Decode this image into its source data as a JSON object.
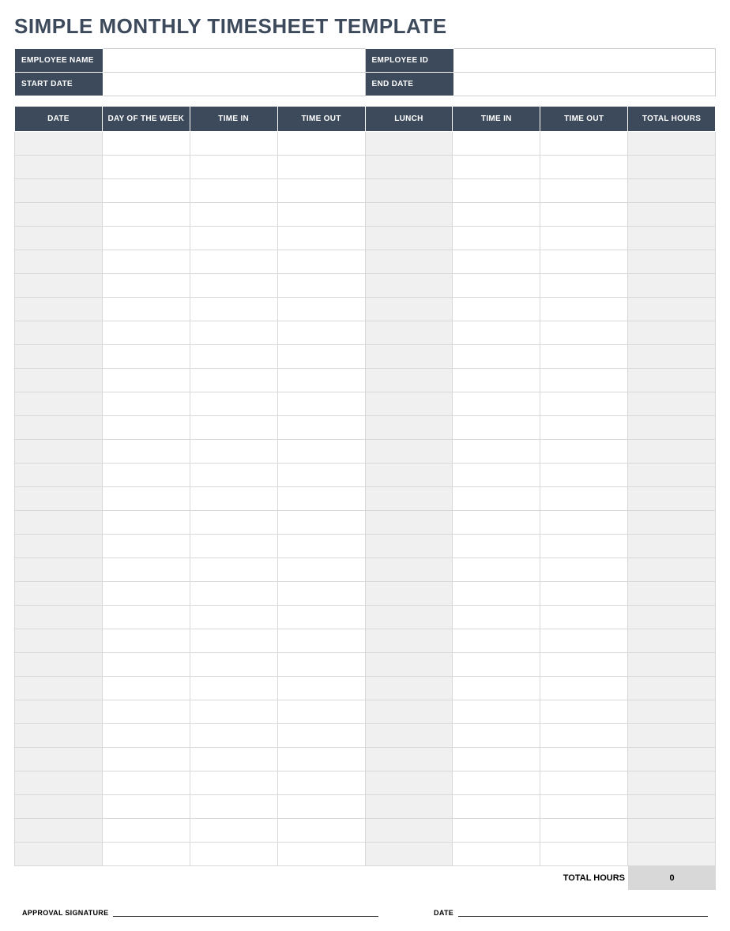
{
  "title": "SIMPLE MONTHLY TIMESHEET TEMPLATE",
  "info": {
    "employee_name_label": "EMPLOYEE NAME",
    "employee_name_value": "",
    "employee_id_label": "EMPLOYEE ID",
    "employee_id_value": "",
    "start_date_label": "START DATE",
    "start_date_value": "",
    "end_date_label": "END DATE",
    "end_date_value": ""
  },
  "columns": {
    "date": "DATE",
    "day_of_week": "DAY OF THE WEEK",
    "time_in_1": "TIME IN",
    "time_out_1": "TIME OUT",
    "lunch": "LUNCH",
    "time_in_2": "TIME IN",
    "time_out_2": "TIME OUT",
    "total_hours": "TOTAL HOURS"
  },
  "rows": [
    {
      "date": "",
      "day": "",
      "time_in_1": "",
      "time_out_1": "",
      "lunch": "",
      "time_in_2": "",
      "time_out_2": "",
      "total": ""
    },
    {
      "date": "",
      "day": "",
      "time_in_1": "",
      "time_out_1": "",
      "lunch": "",
      "time_in_2": "",
      "time_out_2": "",
      "total": ""
    },
    {
      "date": "",
      "day": "",
      "time_in_1": "",
      "time_out_1": "",
      "lunch": "",
      "time_in_2": "",
      "time_out_2": "",
      "total": ""
    },
    {
      "date": "",
      "day": "",
      "time_in_1": "",
      "time_out_1": "",
      "lunch": "",
      "time_in_2": "",
      "time_out_2": "",
      "total": ""
    },
    {
      "date": "",
      "day": "",
      "time_in_1": "",
      "time_out_1": "",
      "lunch": "",
      "time_in_2": "",
      "time_out_2": "",
      "total": ""
    },
    {
      "date": "",
      "day": "",
      "time_in_1": "",
      "time_out_1": "",
      "lunch": "",
      "time_in_2": "",
      "time_out_2": "",
      "total": ""
    },
    {
      "date": "",
      "day": "",
      "time_in_1": "",
      "time_out_1": "",
      "lunch": "",
      "time_in_2": "",
      "time_out_2": "",
      "total": ""
    },
    {
      "date": "",
      "day": "",
      "time_in_1": "",
      "time_out_1": "",
      "lunch": "",
      "time_in_2": "",
      "time_out_2": "",
      "total": ""
    },
    {
      "date": "",
      "day": "",
      "time_in_1": "",
      "time_out_1": "",
      "lunch": "",
      "time_in_2": "",
      "time_out_2": "",
      "total": ""
    },
    {
      "date": "",
      "day": "",
      "time_in_1": "",
      "time_out_1": "",
      "lunch": "",
      "time_in_2": "",
      "time_out_2": "",
      "total": ""
    },
    {
      "date": "",
      "day": "",
      "time_in_1": "",
      "time_out_1": "",
      "lunch": "",
      "time_in_2": "",
      "time_out_2": "",
      "total": ""
    },
    {
      "date": "",
      "day": "",
      "time_in_1": "",
      "time_out_1": "",
      "lunch": "",
      "time_in_2": "",
      "time_out_2": "",
      "total": ""
    },
    {
      "date": "",
      "day": "",
      "time_in_1": "",
      "time_out_1": "",
      "lunch": "",
      "time_in_2": "",
      "time_out_2": "",
      "total": ""
    },
    {
      "date": "",
      "day": "",
      "time_in_1": "",
      "time_out_1": "",
      "lunch": "",
      "time_in_2": "",
      "time_out_2": "",
      "total": ""
    },
    {
      "date": "",
      "day": "",
      "time_in_1": "",
      "time_out_1": "",
      "lunch": "",
      "time_in_2": "",
      "time_out_2": "",
      "total": ""
    },
    {
      "date": "",
      "day": "",
      "time_in_1": "",
      "time_out_1": "",
      "lunch": "",
      "time_in_2": "",
      "time_out_2": "",
      "total": ""
    },
    {
      "date": "",
      "day": "",
      "time_in_1": "",
      "time_out_1": "",
      "lunch": "",
      "time_in_2": "",
      "time_out_2": "",
      "total": ""
    },
    {
      "date": "",
      "day": "",
      "time_in_1": "",
      "time_out_1": "",
      "lunch": "",
      "time_in_2": "",
      "time_out_2": "",
      "total": ""
    },
    {
      "date": "",
      "day": "",
      "time_in_1": "",
      "time_out_1": "",
      "lunch": "",
      "time_in_2": "",
      "time_out_2": "",
      "total": ""
    },
    {
      "date": "",
      "day": "",
      "time_in_1": "",
      "time_out_1": "",
      "lunch": "",
      "time_in_2": "",
      "time_out_2": "",
      "total": ""
    },
    {
      "date": "",
      "day": "",
      "time_in_1": "",
      "time_out_1": "",
      "lunch": "",
      "time_in_2": "",
      "time_out_2": "",
      "total": ""
    },
    {
      "date": "",
      "day": "",
      "time_in_1": "",
      "time_out_1": "",
      "lunch": "",
      "time_in_2": "",
      "time_out_2": "",
      "total": ""
    },
    {
      "date": "",
      "day": "",
      "time_in_1": "",
      "time_out_1": "",
      "lunch": "",
      "time_in_2": "",
      "time_out_2": "",
      "total": ""
    },
    {
      "date": "",
      "day": "",
      "time_in_1": "",
      "time_out_1": "",
      "lunch": "",
      "time_in_2": "",
      "time_out_2": "",
      "total": ""
    },
    {
      "date": "",
      "day": "",
      "time_in_1": "",
      "time_out_1": "",
      "lunch": "",
      "time_in_2": "",
      "time_out_2": "",
      "total": ""
    },
    {
      "date": "",
      "day": "",
      "time_in_1": "",
      "time_out_1": "",
      "lunch": "",
      "time_in_2": "",
      "time_out_2": "",
      "total": ""
    },
    {
      "date": "",
      "day": "",
      "time_in_1": "",
      "time_out_1": "",
      "lunch": "",
      "time_in_2": "",
      "time_out_2": "",
      "total": ""
    },
    {
      "date": "",
      "day": "",
      "time_in_1": "",
      "time_out_1": "",
      "lunch": "",
      "time_in_2": "",
      "time_out_2": "",
      "total": ""
    },
    {
      "date": "",
      "day": "",
      "time_in_1": "",
      "time_out_1": "",
      "lunch": "",
      "time_in_2": "",
      "time_out_2": "",
      "total": ""
    },
    {
      "date": "",
      "day": "",
      "time_in_1": "",
      "time_out_1": "",
      "lunch": "",
      "time_in_2": "",
      "time_out_2": "",
      "total": ""
    },
    {
      "date": "",
      "day": "",
      "time_in_1": "",
      "time_out_1": "",
      "lunch": "",
      "time_in_2": "",
      "time_out_2": "",
      "total": ""
    }
  ],
  "footer": {
    "total_hours_label": "TOTAL HOURS",
    "total_hours_value": "0",
    "approval_signature_label": "APPROVAL SIGNATURE",
    "date_label": "DATE"
  }
}
